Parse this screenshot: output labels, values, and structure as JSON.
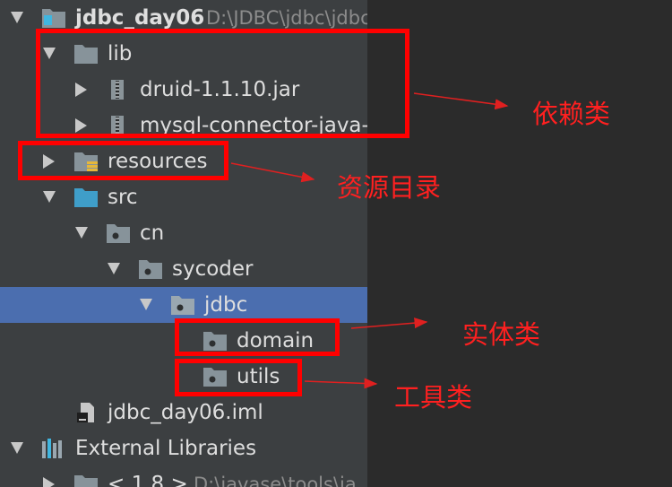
{
  "project": {
    "name": "jdbc_day06",
    "path": "D:\\JDBC\\jdbc\\jdbc"
  },
  "tree": {
    "lib": "lib",
    "druid": "druid-1.1.10.jar",
    "mysql": "mysql-connector-java-",
    "resources": "resources",
    "src": "src",
    "cn": "cn",
    "sycoder": "sycoder",
    "jdbc": "jdbc",
    "domain": "domain",
    "utils": "utils",
    "iml": "jdbc_day06.iml",
    "external": "External Libraries",
    "jdk_name": "< 1.8 >",
    "jdk_path": "D:\\javase\\tools\\ja"
  },
  "annotations": {
    "deps": "依赖类",
    "resources": "资源目录",
    "entity": "实体类",
    "tools": "工具类"
  },
  "colors": {
    "panel": "#3c3f41",
    "selection": "#4b6eaf",
    "annotation": "#ff0000"
  }
}
